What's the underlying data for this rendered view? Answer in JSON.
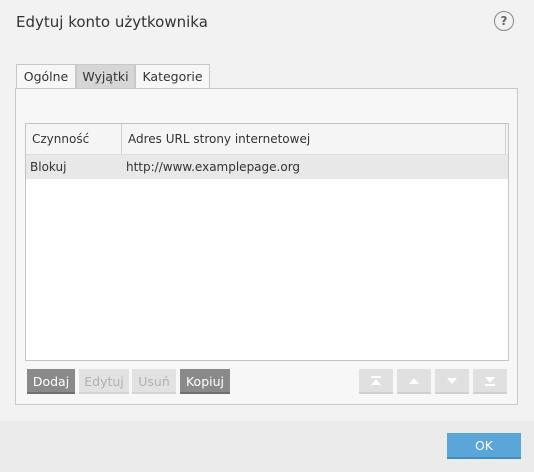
{
  "window": {
    "title": "Edytuj konto użytkownika",
    "help_label": "?"
  },
  "tabs": [
    {
      "label": "Ogólne"
    },
    {
      "label": "Wyjątki"
    },
    {
      "label": "Kategorie"
    }
  ],
  "table": {
    "columns": [
      "Czynność",
      "Adres URL strony internetowej"
    ],
    "rows": [
      {
        "action": "Blokuj",
        "url": "http://www.examplepage.org"
      }
    ]
  },
  "buttons": {
    "add": "Dodaj",
    "edit": "Edytuj",
    "remove": "Usuń",
    "copy": "Kopiuj"
  },
  "footer": {
    "ok": "OK"
  }
}
